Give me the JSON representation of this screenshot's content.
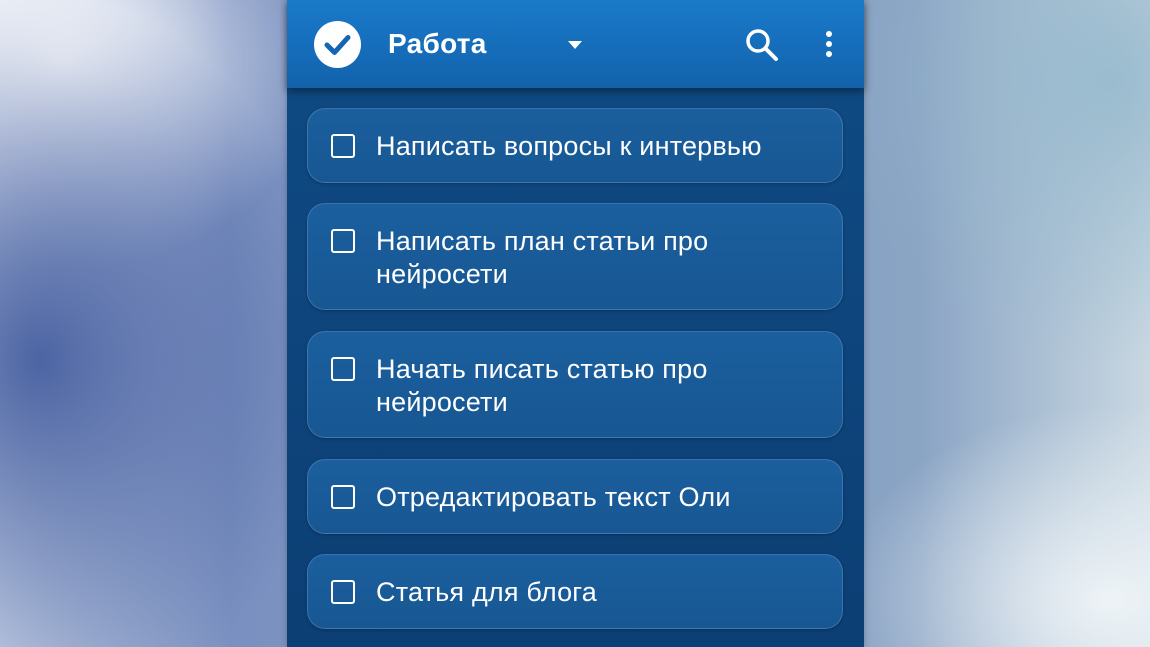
{
  "header": {
    "title": "Работа",
    "logo_icon": "check-circle-icon",
    "dropdown_icon": "caret-down-icon",
    "search_icon": "search-icon",
    "menu_icon": "more-vertical-icon"
  },
  "tasks": [
    {
      "text": "Написать вопросы к интервью",
      "checked": false
    },
    {
      "text": "Написать план статьи про нейросети",
      "checked": false
    },
    {
      "text": "Начать писать статью про нейросети",
      "checked": false
    },
    {
      "text": "Отредактировать текст Оли",
      "checked": false
    },
    {
      "text": "Статья для блога",
      "checked": false
    }
  ],
  "colors": {
    "app_bar": "#156cb8",
    "background": "#0f4b84",
    "card": "#1a5c9a",
    "text": "#ffffff"
  }
}
